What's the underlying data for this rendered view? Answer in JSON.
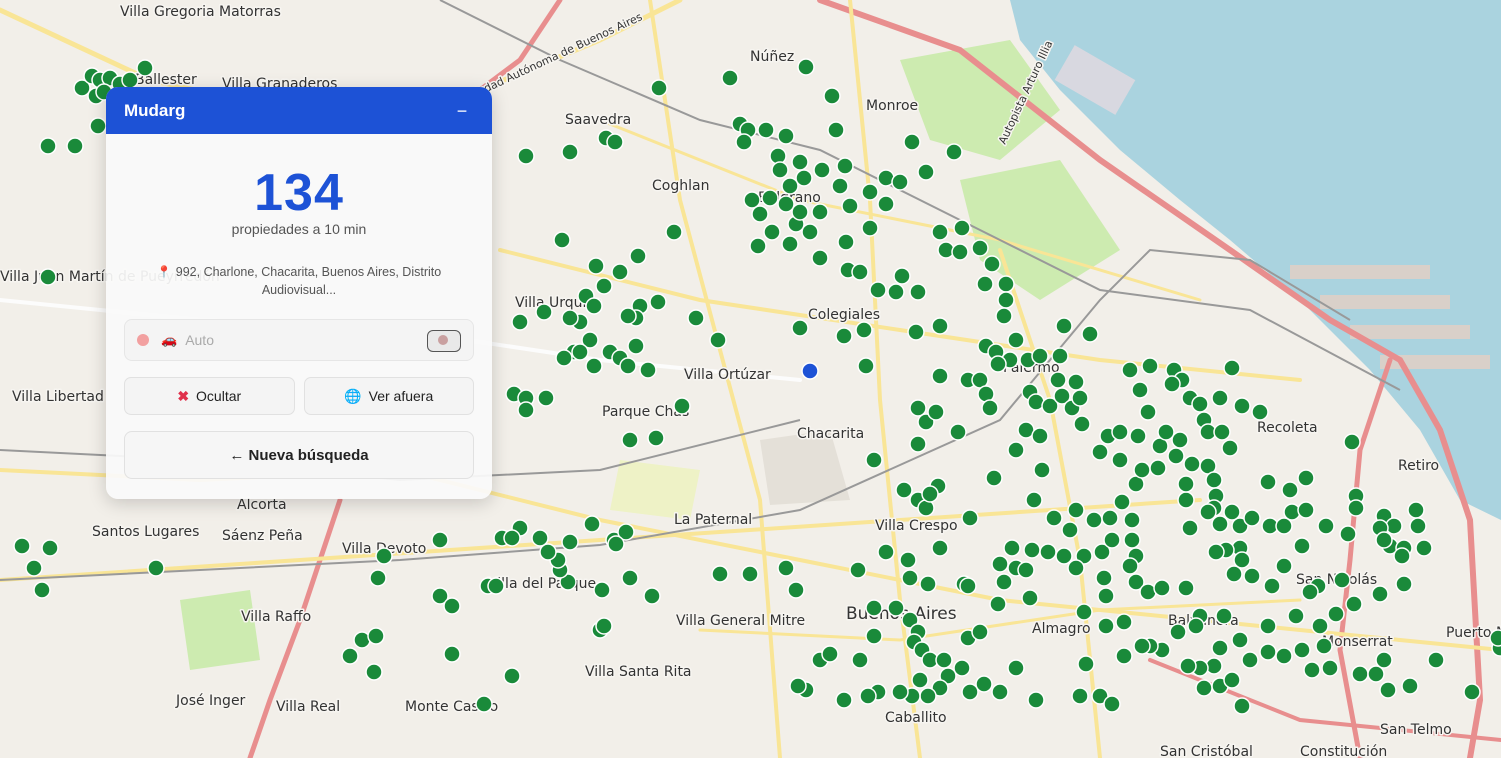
{
  "panel": {
    "title": "Mudarg",
    "minimize_label": "−",
    "count": "134",
    "count_caption": "propiedades a 10 min",
    "address": "992, Charlone, Chacarita, Buenos Aires, Distrito Audiovisual...",
    "mode": {
      "label": "Auto",
      "icon": "car-icon"
    },
    "hide_label": "Ocultar",
    "view_label": "Ver afuera",
    "new_search_label": "← Nueva búsqueda"
  },
  "map": {
    "labels": [
      "Villa Gregoria Matorras",
      "Ballester",
      "Villa Granaderos",
      "Núñez",
      "Saavedra",
      "Coghlan",
      "Belgrano",
      "Colegiales",
      "Villa Urquiza",
      "Villa Ortúzar",
      "Parque Chas",
      "Chacarita",
      "Palermo",
      "Recoleta",
      "Retiro",
      "Villa Crespo",
      "La Paternal",
      "Alcorta",
      "Santos Lugares",
      "Sáenz Peña",
      "Villa Devoto",
      "Villa del Parque",
      "Villa General Mitre",
      "Buenos Aires",
      "Almagro",
      "Balvanera",
      "Monserrat",
      "San Nicolás",
      "Puerto Madero",
      "San Telmo",
      "San Cristóbal",
      "Constitución",
      "Caballito",
      "Villa Santa Rita",
      "Monte Castro",
      "Villa Real",
      "José Inger",
      "Villa Raffo",
      "Villa Libertad",
      "Villa Juan Martín de Pueyrredón",
      "Autopista Arturo Illia",
      "Ciudad Autónoma de Buenos Aires",
      "Monroe"
    ],
    "colors": {
      "water": "#aad3df",
      "property": "#1a8a3a",
      "origin": "#1d52d6"
    }
  }
}
